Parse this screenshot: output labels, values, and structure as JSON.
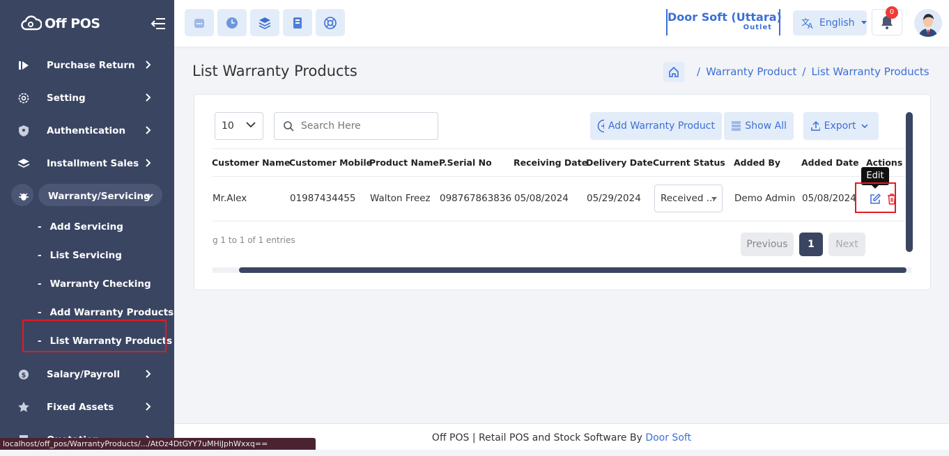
{
  "brand": {
    "name": "Off POS"
  },
  "sidebar": {
    "items": [
      {
        "label": "Purchase Return"
      },
      {
        "label": "Setting"
      },
      {
        "label": "Authentication"
      },
      {
        "label": "Installment Sales"
      },
      {
        "label": "Warranty/Servicing"
      }
    ],
    "sub_items": [
      {
        "label": "Add Servicing"
      },
      {
        "label": "List Servicing"
      },
      {
        "label": "Warranty Checking"
      },
      {
        "label": "Add Warranty Products"
      },
      {
        "label": "List Warranty Products"
      }
    ],
    "items_after": [
      {
        "label": "Salary/Payroll"
      },
      {
        "label": "Fixed Assets"
      },
      {
        "label": "Quotation"
      }
    ]
  },
  "header": {
    "store_name": "Door Soft (Uttara)",
    "store_type": "Outlet",
    "language": "English",
    "notification_count": "0"
  },
  "page": {
    "title": "List Warranty Products",
    "breadcrumb": [
      "Warranty Product",
      "List Warranty Products"
    ],
    "separator": "/"
  },
  "toolbar": {
    "per_page": "10",
    "search_placeholder": "Search Here",
    "add_label": "Add Warranty Product",
    "show_all_label": "Show All",
    "export_label": "Export"
  },
  "table": {
    "columns": [
      "Customer Name",
      "Customer Mobile",
      "Product Name",
      "P.Serial No",
      "Receiving Date",
      "Delivery Date",
      "Current Status",
      "Added By",
      "Added Date",
      "Actions"
    ],
    "rows": [
      {
        "customer_name": "Mr.Alex",
        "customer_mobile": "01987434455",
        "product_name": "Walton Freez",
        "serial_no": "098767863836",
        "receiving_date": "05/08/2024",
        "delivery_date": "05/29/2024",
        "current_status": "Received ...",
        "added_by": "Demo Admin",
        "added_date": "05/08/2024"
      }
    ],
    "info": "g 1 to 1 of 1 entries",
    "tooltip": "Edit"
  },
  "pagination": {
    "previous": "Previous",
    "current": "1",
    "next": "Next"
  },
  "footer": {
    "text": "Off POS | Retail POS and Stock Software By ",
    "link": "Door Soft"
  },
  "status_bar": {
    "url": "localhost/off_pos/WarrantyProducts/.../AtOz4DtGYY7uMHiJphWxxq=="
  },
  "colors": {
    "sidebar": "#3a4562",
    "accent": "#3b6fd6",
    "danger": "#e31b23"
  }
}
